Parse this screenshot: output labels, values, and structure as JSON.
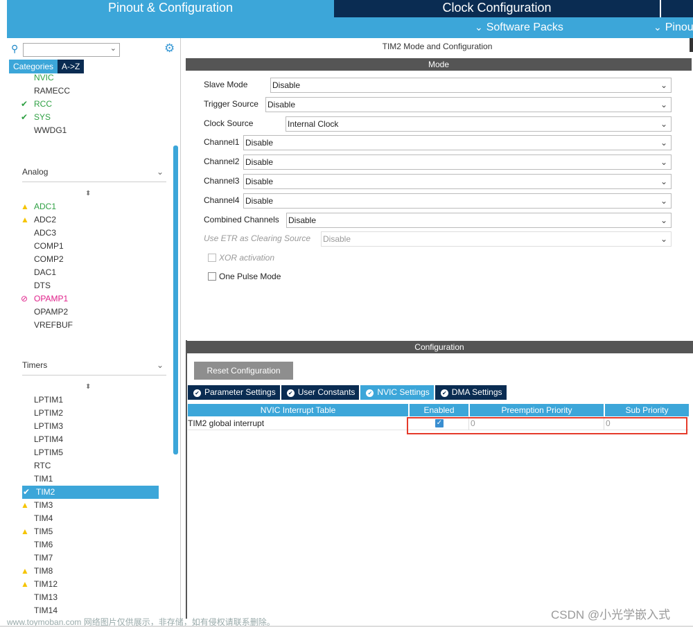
{
  "header": {
    "tabs": [
      "Pinout & Configuration",
      "Clock Configuration",
      ""
    ],
    "sublinks": [
      "Software Packs",
      "Pinout"
    ]
  },
  "sidebar": {
    "category_tabs": [
      "Categories",
      "A->Z"
    ],
    "system_items": [
      {
        "label": "NVIC",
        "state": "green",
        "icon": ""
      },
      {
        "label": "RAMECC",
        "state": "normal",
        "icon": ""
      },
      {
        "label": "RCC",
        "state": "green",
        "icon": "check-icon"
      },
      {
        "label": "SYS",
        "state": "green",
        "icon": "check-icon"
      },
      {
        "label": "WWDG1",
        "state": "normal",
        "icon": ""
      }
    ],
    "analog": {
      "title": "Analog",
      "items": [
        {
          "label": "ADC1",
          "state": "green",
          "icon": "warning-icon"
        },
        {
          "label": "ADC2",
          "state": "normal",
          "icon": "warning-icon"
        },
        {
          "label": "ADC3",
          "state": "normal",
          "icon": ""
        },
        {
          "label": "COMP1",
          "state": "normal",
          "icon": ""
        },
        {
          "label": "COMP2",
          "state": "normal",
          "icon": ""
        },
        {
          "label": "DAC1",
          "state": "normal",
          "icon": ""
        },
        {
          "label": "DTS",
          "state": "normal",
          "icon": ""
        },
        {
          "label": "OPAMP1",
          "state": "pink",
          "icon": "blocked-icon"
        },
        {
          "label": "OPAMP2",
          "state": "normal",
          "icon": ""
        },
        {
          "label": "VREFBUF",
          "state": "normal",
          "icon": ""
        }
      ]
    },
    "timers": {
      "title": "Timers",
      "items": [
        {
          "label": "LPTIM1",
          "state": "normal",
          "icon": ""
        },
        {
          "label": "LPTIM2",
          "state": "normal",
          "icon": ""
        },
        {
          "label": "LPTIM3",
          "state": "normal",
          "icon": ""
        },
        {
          "label": "LPTIM4",
          "state": "normal",
          "icon": ""
        },
        {
          "label": "LPTIM5",
          "state": "normal",
          "icon": ""
        },
        {
          "label": "RTC",
          "state": "normal",
          "icon": ""
        },
        {
          "label": "TIM1",
          "state": "normal",
          "icon": ""
        },
        {
          "label": "TIM2",
          "state": "selected",
          "icon": "check-circle-icon"
        },
        {
          "label": "TIM3",
          "state": "normal",
          "icon": "warning-icon"
        },
        {
          "label": "TIM4",
          "state": "normal",
          "icon": ""
        },
        {
          "label": "TIM5",
          "state": "normal",
          "icon": "warning-icon"
        },
        {
          "label": "TIM6",
          "state": "normal",
          "icon": ""
        },
        {
          "label": "TIM7",
          "state": "normal",
          "icon": ""
        },
        {
          "label": "TIM8",
          "state": "normal",
          "icon": "warning-icon"
        },
        {
          "label": "TIM12",
          "state": "normal",
          "icon": "warning-icon"
        },
        {
          "label": "TIM13",
          "state": "normal",
          "icon": ""
        },
        {
          "label": "TIM14",
          "state": "normal",
          "icon": ""
        }
      ]
    }
  },
  "main": {
    "title": "TIM2 Mode and Configuration",
    "mode_bar": "Mode",
    "fields": [
      {
        "label": "Slave Mode",
        "value": "Disable",
        "disabled": false
      },
      {
        "label": "Trigger Source",
        "value": "Disable",
        "disabled": false
      },
      {
        "label": "Clock Source",
        "value": "Internal Clock",
        "disabled": false
      },
      {
        "label": "Channel1",
        "value": "Disable",
        "disabled": false
      },
      {
        "label": "Channel2",
        "value": "Disable",
        "disabled": false
      },
      {
        "label": "Channel3",
        "value": "Disable",
        "disabled": false
      },
      {
        "label": "Channel4",
        "value": "Disable",
        "disabled": false
      },
      {
        "label": "Combined Channels",
        "value": "Disable",
        "disabled": false
      },
      {
        "label": "Use ETR as Clearing Source",
        "value": "Disable",
        "disabled": true
      }
    ],
    "checkboxes": [
      {
        "label": "XOR activation",
        "checked": false,
        "disabled": true
      },
      {
        "label": "One Pulse Mode",
        "checked": false,
        "disabled": false
      }
    ],
    "config_bar": "Configuration",
    "reset_label": "Reset Configuration",
    "config_tabs": [
      "Parameter Settings",
      "User Constants",
      "NVIC Settings",
      "DMA Settings"
    ],
    "active_config_tab": "NVIC Settings",
    "table": {
      "headers": [
        "NVIC Interrupt Table",
        "Enabled",
        "Preemption Priority",
        "Sub Priority"
      ],
      "rows": [
        {
          "name": "TIM2 global interrupt",
          "enabled": true,
          "preemption": "0",
          "sub": "0"
        }
      ]
    }
  },
  "watermarks": {
    "left": "www.toymoban.com 网络图片仅供展示，非存储，如有侵权请联系删除。",
    "right": "CSDN @小光学嵌入式"
  },
  "colors": {
    "accent": "#3ca6d9",
    "dark": "#0a2c52",
    "green": "#2ea043",
    "warning": "#f5c400",
    "pink": "#e0208a",
    "highlight": "#e53a2a"
  }
}
